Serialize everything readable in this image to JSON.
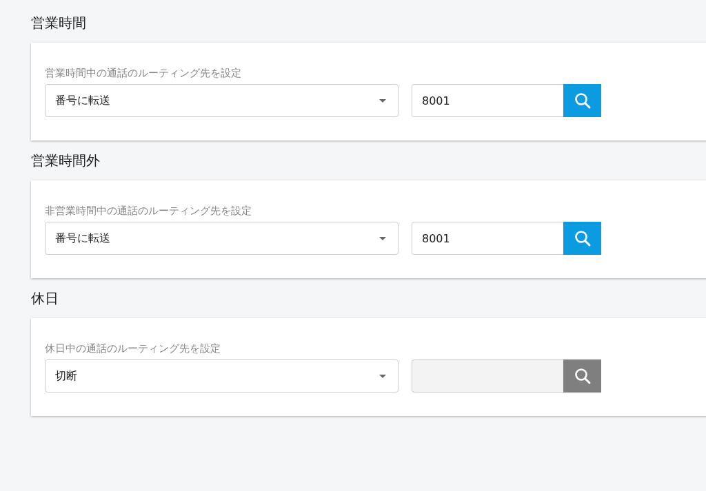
{
  "sections": [
    {
      "title": "営業時間",
      "label": "営業時間中の通話のルーティング先を設定",
      "select": "番号に転送",
      "number": {
        "value": "8001",
        "disabled": false
      }
    },
    {
      "title": "営業時間外",
      "label": "非営業時間中の通話のルーティング先を設定",
      "select": "番号に転送",
      "number": {
        "value": "8001",
        "disabled": false
      }
    },
    {
      "title": "休日",
      "label": "休日中の通話のルーティング先を設定",
      "select": "切断",
      "number": {
        "disabled": true
      }
    }
  ]
}
